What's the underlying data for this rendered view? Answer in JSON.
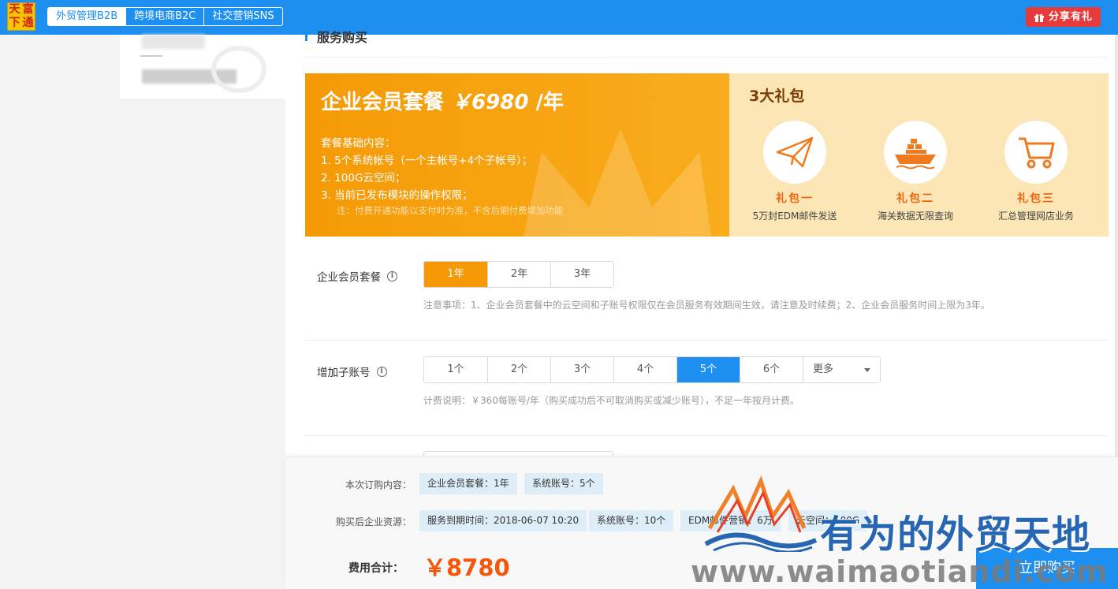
{
  "logo": {
    "chars": [
      "天",
      "富",
      "下",
      "通"
    ]
  },
  "nav": {
    "tabs": [
      "外贸管理B2B",
      "跨境电商B2C",
      "社交营销SNS"
    ],
    "active": 0
  },
  "share_button": "分享有礼",
  "section_title": "服务购买",
  "banner": {
    "title": "企业会员套餐",
    "price": "￥6980",
    "unit": "/年",
    "heading": "套餐基础内容：",
    "lines": [
      "1. 5个系统帐号（一个主帐号+4个子帐号）；",
      "2. 100G云空间；",
      "3. 当前已发布模块的操作权限；"
    ],
    "note": "注：付费开通功能以支付时为准，不含后期付费增加功能"
  },
  "gifts": {
    "title": "3大礼包",
    "items": [
      {
        "name": "礼包一",
        "desc": "5万封EDM邮件发送",
        "icon": "paper-plane-icon"
      },
      {
        "name": "礼包二",
        "desc": "海关数据无限查询",
        "icon": "cargo-ship-icon"
      },
      {
        "name": "礼包三",
        "desc": "汇总管理网店业务",
        "icon": "shopping-cart-icon"
      }
    ]
  },
  "membership": {
    "label": "企业会员套餐",
    "options": [
      "1年",
      "2年",
      "3年"
    ],
    "selected": 0,
    "tip": "注意事项：1、企业会员套餐中的云空间和子账号权限仅在会员服务有效期间生效，请注意及时续费；2、企业会员服务时间上限为3年。"
  },
  "subaccounts": {
    "label": "增加子账号",
    "options": [
      "1个",
      "2个",
      "3个",
      "4个",
      "5个",
      "6个"
    ],
    "more": "更多",
    "selected": 4,
    "tip": "计费说明：￥360每账号/年（购买成功后不可取消购买或减少账号），不足一年按月计费。"
  },
  "order": {
    "label": "本次订购内容：",
    "tags": [
      "企业会员套餐：1年",
      "系统账号：5个"
    ]
  },
  "resources": {
    "label": "购买后企业资源：",
    "tags": [
      "服务到期时间：2018-06-07 10:20",
      "系统账号：10个",
      "EDM邮件营销：6万",
      "云空间：200G"
    ]
  },
  "total": {
    "label": "费用合计：",
    "price": "￥8780"
  },
  "buy_button": "立即购买",
  "watermark": {
    "text": "有为的外贸天地",
    "url": "www.waimaotiandi.com"
  },
  "colors": {
    "primary": "#1c8ff0",
    "orange": "#f59a06",
    "price": "#f5560a",
    "share": "#e83a3a"
  }
}
